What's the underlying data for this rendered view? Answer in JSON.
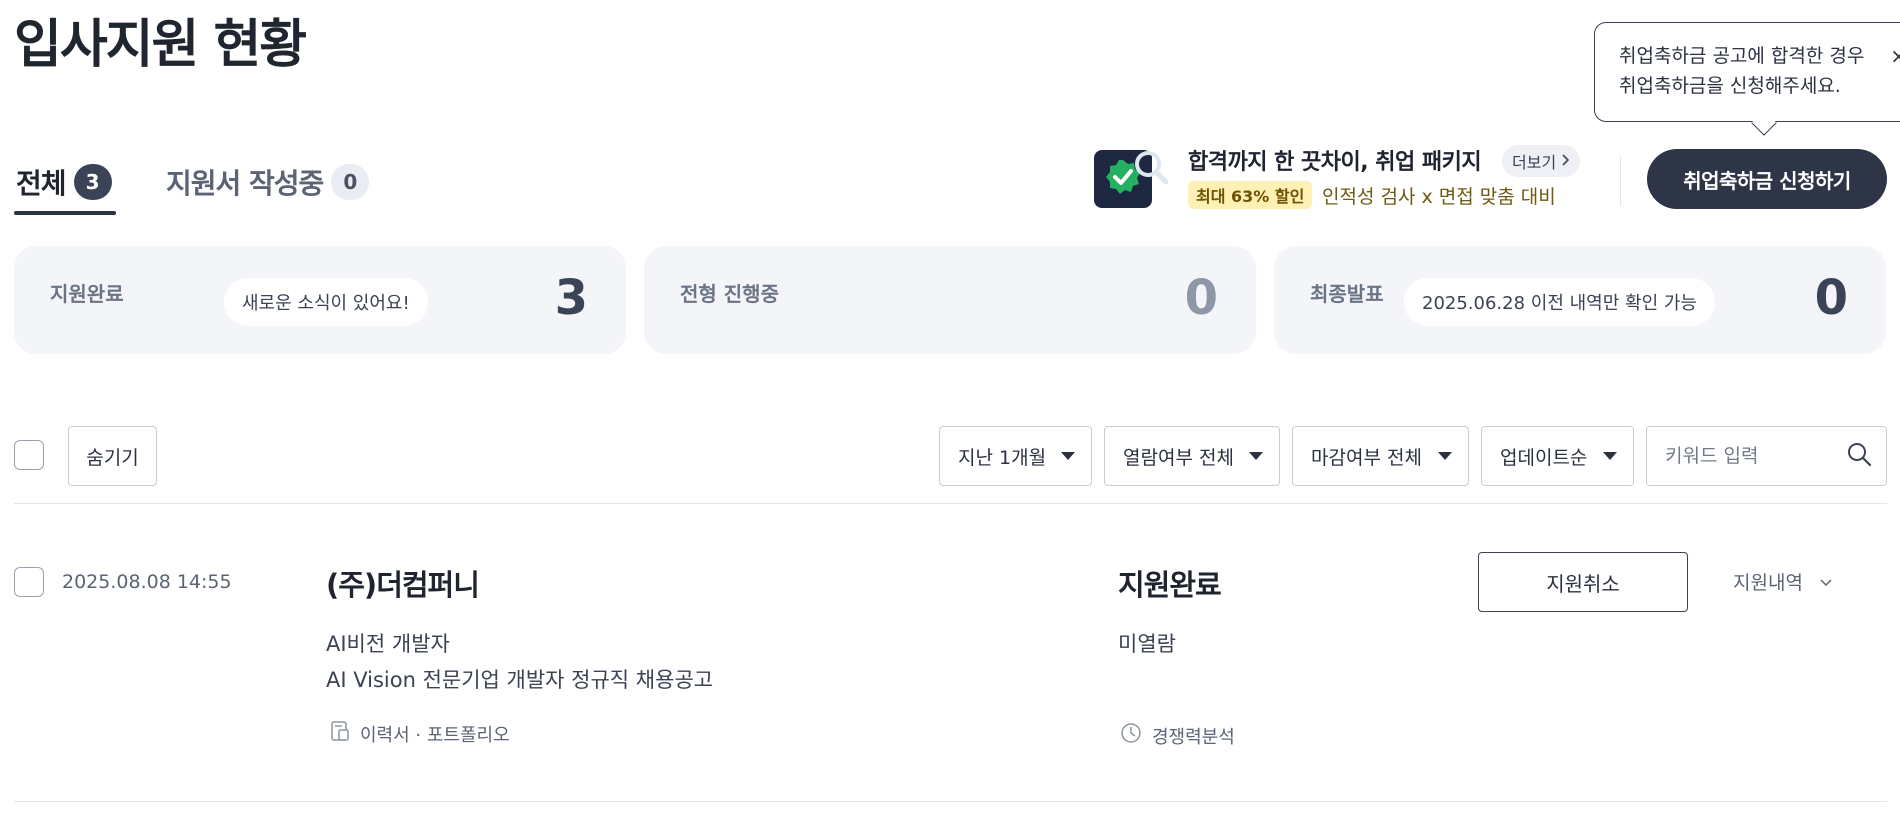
{
  "page": {
    "title": "입사지원 현황"
  },
  "tooltip": {
    "line1": "취업축하금 공고에 합격한 경우",
    "line2": "취업축하금을 신청해주세요.",
    "close": "×"
  },
  "tabs": [
    {
      "label": "전체",
      "count": "3",
      "active": true
    },
    {
      "label": "지원서 작성중",
      "count": "0",
      "active": false
    }
  ],
  "promo": {
    "title": "합격까지 한 끗차이, 취업 패키지",
    "more": "더보기",
    "discount": "최대 63% 할인",
    "subtitle": "인적성 검사 x 면접 맞춤 대비"
  },
  "cta": {
    "label": "취업축하금 신청하기"
  },
  "stats": [
    {
      "label": "지원완료",
      "chip": "새로운 소식이 있어요!",
      "count": "3",
      "count_color": "#3b4356"
    },
    {
      "label": "전형 진행중",
      "chip": "",
      "count": "0",
      "count_color": "#8d97a8"
    },
    {
      "label": "최종발표",
      "chip": "2025.06.28 이전 내역만 확인 가능",
      "count": "0",
      "count_color": "#3b4356"
    }
  ],
  "filters": {
    "hide_label": "숨기기",
    "period": "지난 1개월",
    "read_status": "열람여부 전체",
    "deadline_status": "마감여부 전체",
    "sort": "업데이트순",
    "search_placeholder": "키워드 입력"
  },
  "applications": [
    {
      "date": "2025.08.08 14:55",
      "company": "(주)더컴퍼니",
      "position": "AI비전 개발자",
      "posting": "AI Vision 전문기업 개발자 정규직 채용공고",
      "documents": "이력서 · 포트폴리오",
      "status": "지원완료",
      "read_status": "미열람",
      "analysis": "경쟁력분석",
      "cancel_label": "지원취소",
      "history_label": "지원내역"
    }
  ],
  "colors": {
    "primary_dark": "#2e3547",
    "card_bg": "#f3f5f8",
    "promo_yellow": "#fff0b5"
  }
}
